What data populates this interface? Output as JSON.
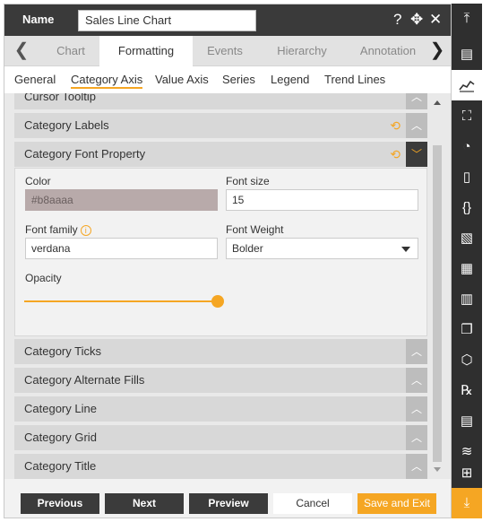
{
  "header": {
    "name_label": "Name",
    "name_value": "Sales Line Chart",
    "icons": [
      "help-icon",
      "move-icon",
      "close-icon"
    ],
    "help_glyph": "?",
    "move_glyph": "✥",
    "close_glyph": "✕"
  },
  "tabs": {
    "prev_glyph": "❮",
    "next_glyph": "❯",
    "items": [
      "Chart",
      "Formatting",
      "Events",
      "Hierarchy",
      "Annotation"
    ],
    "active": "Formatting"
  },
  "subtabs": {
    "items": [
      "General",
      "Category Axis",
      "Value Axis",
      "Series",
      "Legend",
      "Trend Lines"
    ],
    "active": "Category Axis"
  },
  "sections": {
    "cursor_tooltip": "Cursor Tooltip",
    "category_labels": "Category Labels",
    "category_font_property": "Category Font Property",
    "category_ticks": "Category Ticks",
    "category_alternate_fills": "Category Alternate Fills",
    "category_line": "Category Line",
    "category_grid": "Category Grid",
    "category_title": "Category Title"
  },
  "glyphs": {
    "collapse": "︿",
    "expand": "﹀",
    "refresh": "⟲"
  },
  "font_property": {
    "color_label": "Color",
    "color_value": "#b8aaaa",
    "font_size_label": "Font size",
    "font_size_value": "15",
    "font_family_label": "Font family",
    "info_glyph": "i",
    "font_family_value": "verdana",
    "font_weight_label": "Font Weight",
    "font_weight_value": "Bolder",
    "opacity_label": "Opacity",
    "opacity_value": 1
  },
  "footer": {
    "previous": "Previous",
    "next": "Next",
    "preview": "Preview",
    "cancel": "Cancel",
    "save_exit": "Save and Exit"
  },
  "rail": {
    "top_glyph": "⤒",
    "bottom_glyph": "⤓",
    "icons": [
      "collapse-top-icon",
      "table-icon",
      "line-chart-icon",
      "map-icon",
      "document-chart-icon",
      "file-icon",
      "braces-icon",
      "image-icon",
      "calendar-grid-icon",
      "bar-chart-icon",
      "copy-icon",
      "hierarchy-icon",
      "rx-icon",
      "report-icon",
      "layers-icon",
      "nodes-icon",
      "download-icon"
    ],
    "glyphs": [
      "▤",
      "📈",
      "⛶",
      "◔",
      "▯",
      "{}",
      "▧",
      "▦",
      "▥",
      "❐",
      "⬡",
      "℞",
      "▤",
      "≋",
      "⊞"
    ]
  },
  "colors": {
    "accent": "#f5a623",
    "header_bg": "#3a3a3a",
    "rail_bg": "#2f2f2f"
  }
}
